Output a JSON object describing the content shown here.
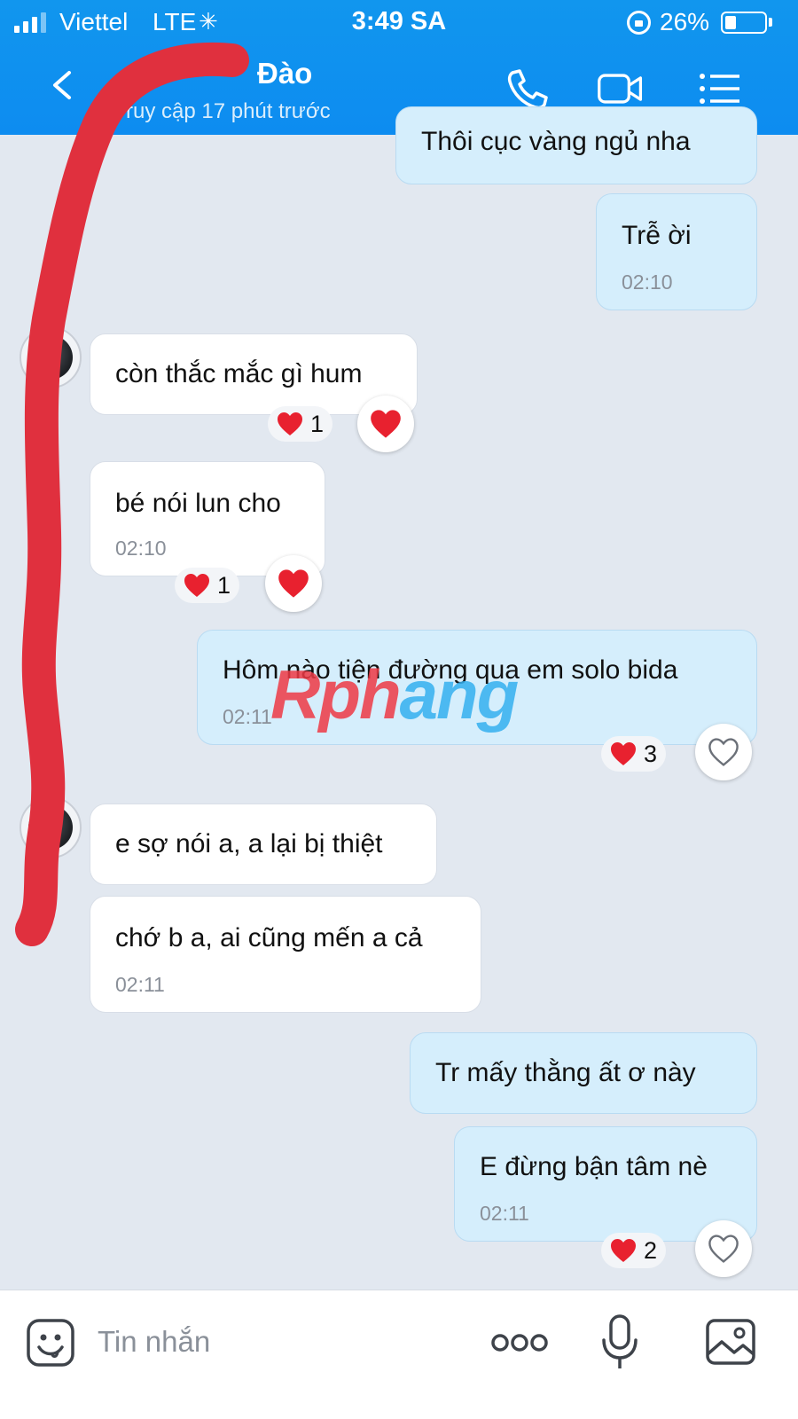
{
  "status_bar": {
    "carrier": "Viettel",
    "network": "LTE",
    "time": "3:49 SA",
    "battery": "26%",
    "battery_level": 0.26
  },
  "header": {
    "contact_name": "Đào",
    "last_seen": "ruy cập 17 phút trước",
    "icons": [
      "back-icon",
      "phone-icon",
      "video-call-icon",
      "menu-list-icon"
    ]
  },
  "messages": [
    {
      "side": "out",
      "text": "Thôi cục vàng ngủ nha"
    },
    {
      "side": "out",
      "text": "Trễ ời",
      "time": "02:10"
    },
    {
      "side": "in",
      "text": "còn thắc mắc gì hum",
      "reaction_count": "1"
    },
    {
      "side": "in",
      "text": "bé nói lun cho",
      "time": "02:10",
      "reaction_count": "1"
    },
    {
      "side": "out",
      "text": "Hôm nào tiện đường qua em solo bida",
      "time": "02:11",
      "reaction_count": "3"
    },
    {
      "side": "in",
      "text": "e sợ nói a, a lại bị thiệt"
    },
    {
      "side": "in",
      "text": "chớ b a, ai cũng mến a cả",
      "time": "02:11"
    },
    {
      "side": "out",
      "text": "Tr mấy thằng ất ơ này"
    },
    {
      "side": "out",
      "text": "E đừng bận tâm nè",
      "time": "02:11",
      "reaction_count": "2"
    }
  ],
  "watermark": {
    "part_a": "Rph",
    "part_b": "ang"
  },
  "input_bar": {
    "placeholder": "Tin nhắn",
    "icons": [
      "sticker-icon",
      "more-dots-icon",
      "microphone-icon",
      "image-icon"
    ]
  },
  "colors": {
    "header_blue": "#0d8cf0",
    "outgoing_bubble": "#d5eefc",
    "incoming_bubble": "#ffffff",
    "heart_red": "#e8212f",
    "scribble_red": "#e0303e"
  }
}
